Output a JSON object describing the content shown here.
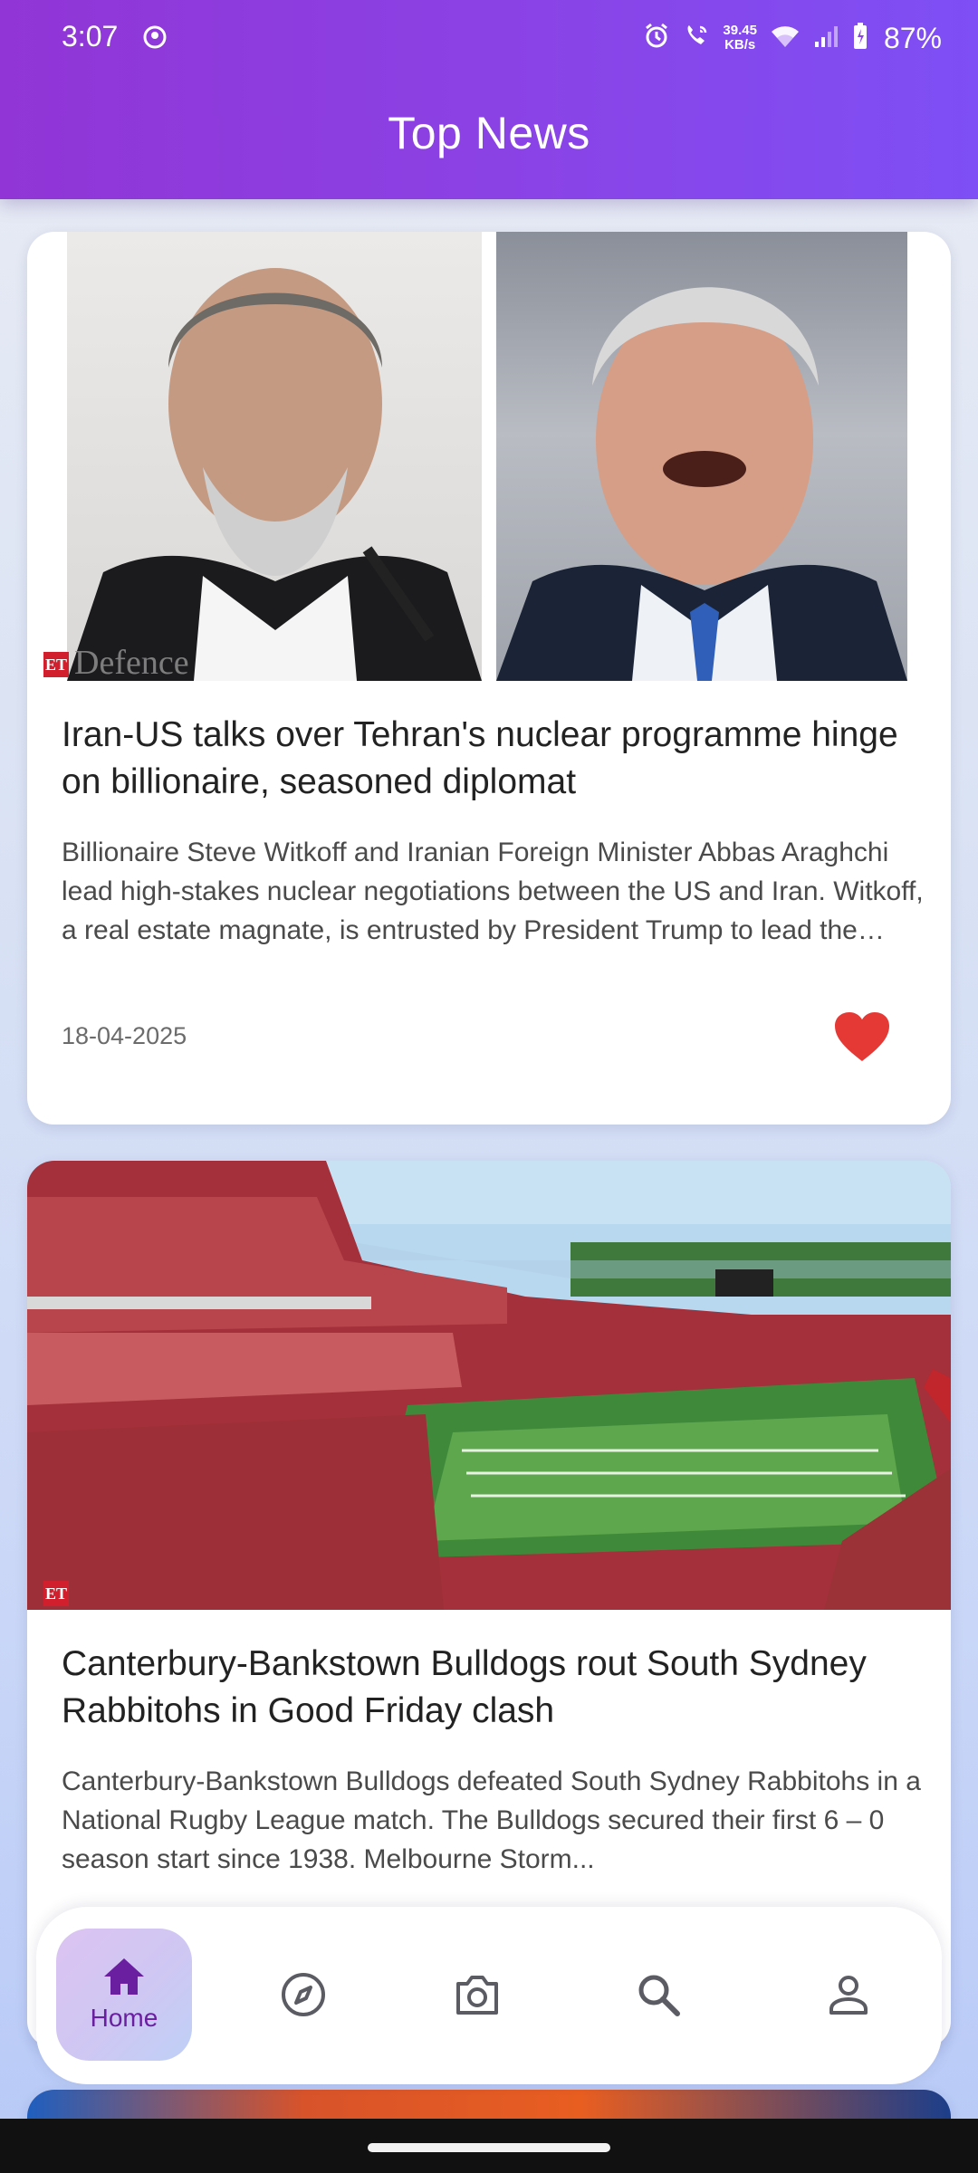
{
  "status_bar": {
    "time": "3:07",
    "net_speed_value": "39.45",
    "net_speed_unit": "KB/s",
    "battery": "87%"
  },
  "header": {
    "title": "Top News"
  },
  "articles": [
    {
      "title": "Iran-US talks over Tehran's nuclear programme hinge on billionaire, seasoned diplomat",
      "description": "Billionaire Steve Witkoff and Iranian Foreign Minister Abbas Araghchi lead high-stakes nuclear negotiations between the US and Iran. Witkoff, a real estate magnate, is entrusted by President Trump to lead the talks...",
      "date": "18-04-2025",
      "image_logo": "ET",
      "image_watermark": "Defence",
      "favorited": true
    },
    {
      "title": "Canterbury-Bankstown Bulldogs rout South Sydney Rabbitohs in Good Friday clash",
      "description": "Canterbury-Bankstown Bulldogs defeated South Sydney Rabbitohs in a National Rugby League match. The Bulldogs secured their first 6 – 0 season start since 1938. Melbourne Storm...",
      "image_logo": "ET"
    }
  ],
  "bottom_nav": {
    "items": [
      {
        "label": "Home",
        "icon": "home-icon",
        "active": true
      },
      {
        "icon": "compass-icon"
      },
      {
        "icon": "camera-icon"
      },
      {
        "icon": "search-icon"
      },
      {
        "icon": "profile-icon"
      }
    ]
  },
  "colors": {
    "header_gradient_start": "#9135d6",
    "header_gradient_end": "#7e4ff5",
    "heart": "#e53935",
    "nav_active_text": "#6a1fa0"
  }
}
